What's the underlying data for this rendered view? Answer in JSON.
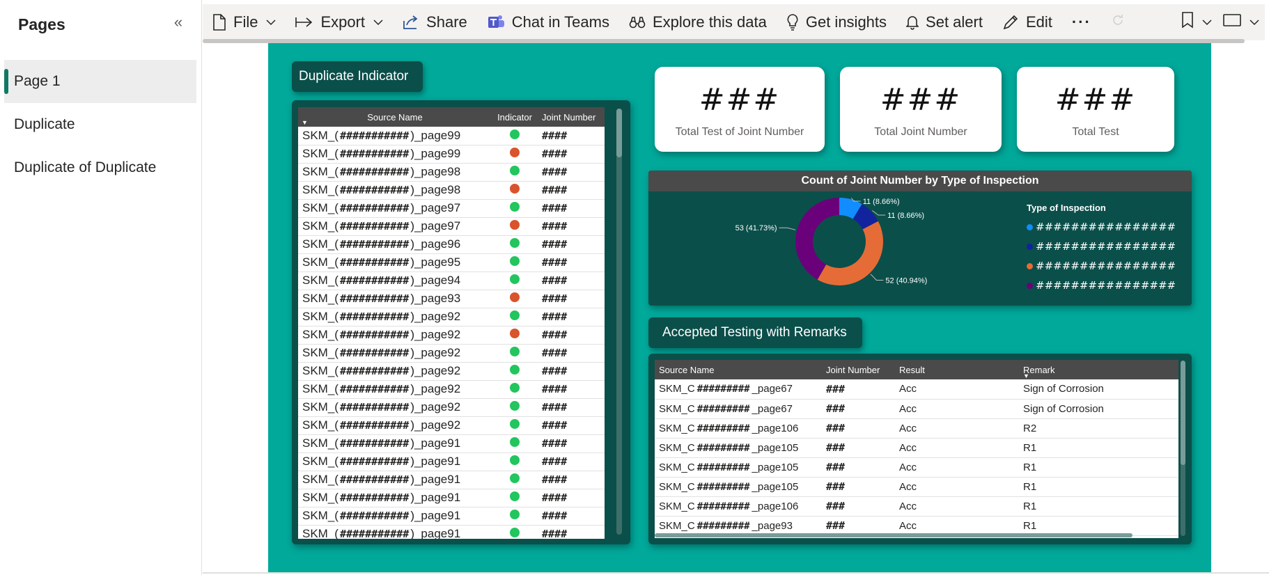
{
  "sidebar": {
    "title": "Pages",
    "collapse_icon": "«",
    "items": [
      {
        "label": "Page 1",
        "active": true
      },
      {
        "label": "Duplicate",
        "active": false
      },
      {
        "label": "Duplicate of Duplicate",
        "active": false
      }
    ]
  },
  "toolbar": {
    "file": "File",
    "export": "Export",
    "share": "Share",
    "teams": "Chat in Teams",
    "explore": "Explore this data",
    "insights": "Get insights",
    "alert": "Set alert",
    "edit": "Edit",
    "more": "···"
  },
  "duplicate_indicator": {
    "title": "Duplicate Indicator",
    "columns": [
      "Source Name",
      "Indicator",
      "Joint Number"
    ],
    "rows": [
      {
        "prefix": "SKM_(",
        "masked": "###########",
        "suffix": ")_page99",
        "status": "green",
        "joint": "####"
      },
      {
        "prefix": "SKM_(",
        "masked": "###########",
        "suffix": ")_page99",
        "status": "red",
        "joint": "####"
      },
      {
        "prefix": "SKM_(",
        "masked": "###########",
        "suffix": ")_page98",
        "status": "green",
        "joint": "####"
      },
      {
        "prefix": "SKM_(",
        "masked": "###########",
        "suffix": ")_page98",
        "status": "red",
        "joint": "####"
      },
      {
        "prefix": "SKM_(",
        "masked": "###########",
        "suffix": ")_page97",
        "status": "green",
        "joint": "####"
      },
      {
        "prefix": "SKM_(",
        "masked": "###########",
        "suffix": ")_page97",
        "status": "red",
        "joint": "####"
      },
      {
        "prefix": "SKM_(",
        "masked": "###########",
        "suffix": ")_page96",
        "status": "green",
        "joint": "####"
      },
      {
        "prefix": "SKM_(",
        "masked": "###########",
        "suffix": ")_page95",
        "status": "green",
        "joint": "####"
      },
      {
        "prefix": "SKM_(",
        "masked": "###########",
        "suffix": ")_page94",
        "status": "green",
        "joint": "####"
      },
      {
        "prefix": "SKM_(",
        "masked": "###########",
        "suffix": ")_page93",
        "status": "red",
        "joint": "####"
      },
      {
        "prefix": "SKM_(",
        "masked": "###########",
        "suffix": ")_page92",
        "status": "green",
        "joint": "####"
      },
      {
        "prefix": "SKM_(",
        "masked": "###########",
        "suffix": ")_page92",
        "status": "red",
        "joint": "####"
      },
      {
        "prefix": "SKM_(",
        "masked": "###########",
        "suffix": ")_page92",
        "status": "green",
        "joint": "####"
      },
      {
        "prefix": "SKM_(",
        "masked": "###########",
        "suffix": ")_page92",
        "status": "green",
        "joint": "####"
      },
      {
        "prefix": "SKM_(",
        "masked": "###########",
        "suffix": ")_page92",
        "status": "green",
        "joint": "####"
      },
      {
        "prefix": "SKM_(",
        "masked": "###########",
        "suffix": ")_page92",
        "status": "green",
        "joint": "####"
      },
      {
        "prefix": "SKM_(",
        "masked": "###########",
        "suffix": ")_page92",
        "status": "green",
        "joint": "####"
      },
      {
        "prefix": "SKM_(",
        "masked": "###########",
        "suffix": ")_page91",
        "status": "green",
        "joint": "####"
      },
      {
        "prefix": "SKM_(",
        "masked": "###########",
        "suffix": ")_page91",
        "status": "green",
        "joint": "####"
      },
      {
        "prefix": "SKM_(",
        "masked": "###########",
        "suffix": ")_page91",
        "status": "green",
        "joint": "####"
      },
      {
        "prefix": "SKM_(",
        "masked": "###########",
        "suffix": ")_page91",
        "status": "green",
        "joint": "####"
      },
      {
        "prefix": "SKM_(",
        "masked": "###########",
        "suffix": ")_page91",
        "status": "green",
        "joint": "####"
      },
      {
        "prefix": "SKM_(",
        "masked": "###########",
        "suffix": ")_page91",
        "status": "green",
        "joint": "####"
      }
    ]
  },
  "kpis": [
    {
      "value": "###",
      "label": "Total Test of Joint Number"
    },
    {
      "value": "###",
      "label": "Total Joint Number"
    },
    {
      "value": "###",
      "label": "Total Test"
    }
  ],
  "donut": {
    "title": "Count of Joint Number by Type of Inspection",
    "legend_title": "Type of Inspection",
    "masked_label": "################",
    "colors": [
      "#118dff",
      "#12239e",
      "#e66c37",
      "#6b007b"
    ]
  },
  "chart_data": {
    "type": "pie",
    "title": "Count of Joint Number by Type of Inspection",
    "legend_title": "Type of Inspection",
    "values": [
      11,
      11,
      52,
      53
    ],
    "labels": [
      "11 (8.66%)",
      "11 (8.66%)",
      "52 (40.94%)",
      "53 (41.73%)"
    ],
    "categories": [
      "################",
      "################",
      "################",
      "################"
    ]
  },
  "remarks": {
    "title": "Accepted Testing with Remarks",
    "columns": [
      "Source Name",
      "Joint Number",
      "Result",
      "Remark"
    ],
    "rows": [
      {
        "prefix": "SKM_C",
        "masked": "#########",
        "suffix": "_page67",
        "joint": "###",
        "result": "Acc",
        "remark": "Sign of Corrosion"
      },
      {
        "prefix": "SKM_C",
        "masked": "#########",
        "suffix": "_page67",
        "joint": "###",
        "result": "Acc",
        "remark": "Sign of Corrosion"
      },
      {
        "prefix": "SKM_C",
        "masked": "#########",
        "suffix": "_page106",
        "joint": "###",
        "result": "Acc",
        "remark": "R2"
      },
      {
        "prefix": "SKM_C",
        "masked": "#########",
        "suffix": "_page105",
        "joint": "###",
        "result": "Acc",
        "remark": "R1"
      },
      {
        "prefix": "SKM_C",
        "masked": "#########",
        "suffix": "_page105",
        "joint": "###",
        "result": "Acc",
        "remark": "R1"
      },
      {
        "prefix": "SKM_C",
        "masked": "#########",
        "suffix": "_page105",
        "joint": "###",
        "result": "Acc",
        "remark": "R1"
      },
      {
        "prefix": "SKM_C",
        "masked": "#########",
        "suffix": "_page106",
        "joint": "###",
        "result": "Acc",
        "remark": "R1"
      },
      {
        "prefix": "SKM_C",
        "masked": "#########",
        "suffix": "_page93",
        "joint": "###",
        "result": "Acc",
        "remark": "R1"
      }
    ]
  },
  "status_colors": {
    "green": "#22c55e",
    "red": "#d9532c"
  }
}
